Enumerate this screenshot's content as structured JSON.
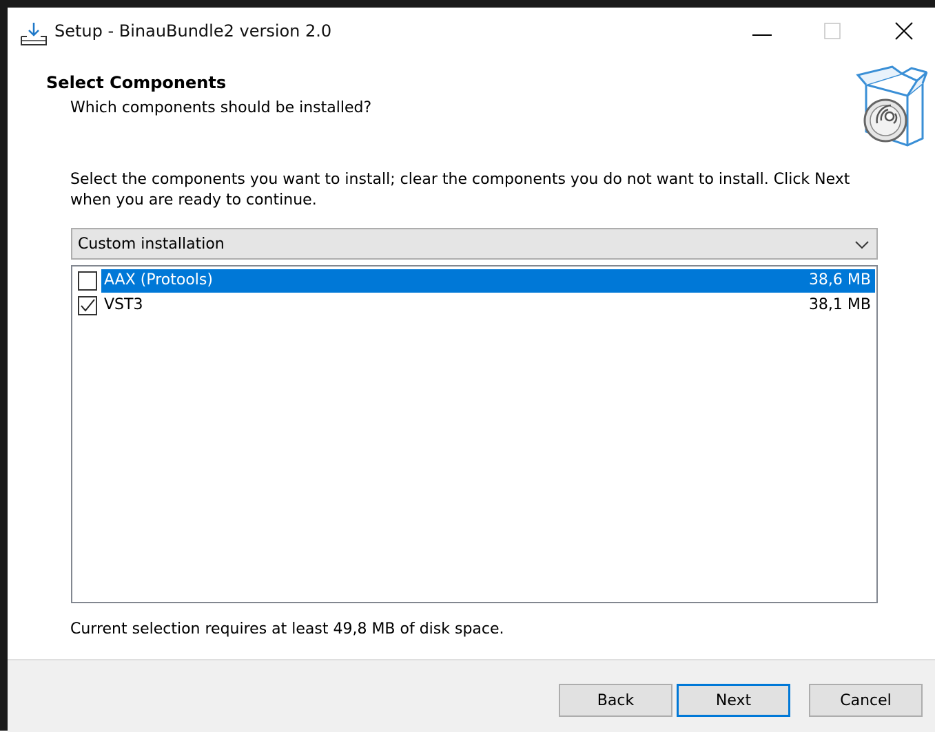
{
  "window": {
    "title": "Setup - BinauBundle2 version 2.0"
  },
  "header": {
    "title": "Select Components",
    "subtitle": "Which components should be installed?"
  },
  "instructions": "Select the components you want to install; clear the components you do not want to install. Click Next when you are ready to continue.",
  "install_type": {
    "selected": "Custom installation"
  },
  "components": [
    {
      "label": "AAX (Protools)",
      "size": "38,6 MB",
      "checked": false,
      "selected": true
    },
    {
      "label": "VST3",
      "size": "38,1 MB",
      "checked": true,
      "selected": false
    }
  ],
  "disk_space": "Current selection requires at least 49,8 MB of disk space.",
  "buttons": {
    "back": "Back",
    "next": "Next",
    "cancel": "Cancel"
  },
  "colors": {
    "accent": "#0078d7",
    "footer_bg": "#f0f0f0"
  },
  "icons": {
    "app": "setup-download-icon",
    "header_graphic": "box-disc-icon"
  }
}
